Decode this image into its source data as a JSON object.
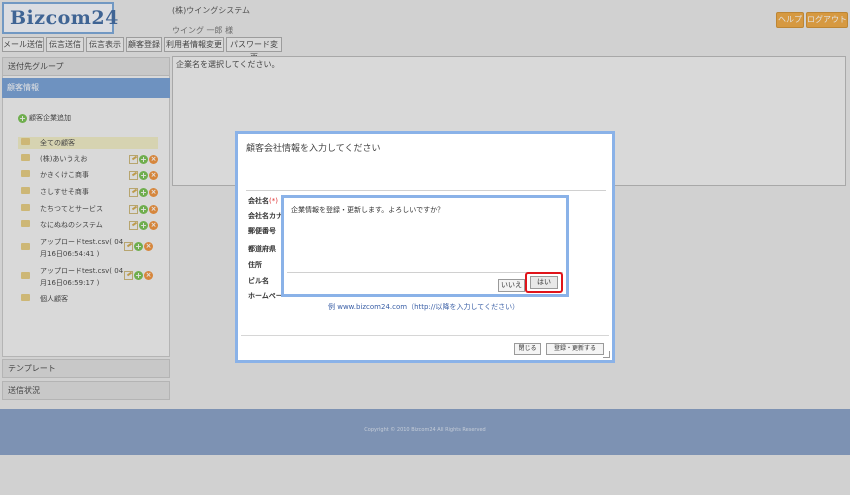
{
  "header": {
    "logo": "Bizcom24",
    "company": "(株)ウイングシステム",
    "user": "ウイング 一郎 様",
    "help_label": "ヘルプ",
    "logout_label": "ログアウト"
  },
  "nav": [
    "メール送信",
    "伝言送信",
    "伝言表示",
    "顧客登録",
    "利用者情報変更",
    "パスワード変更"
  ],
  "sidebar": {
    "send_group": "送付先グループ",
    "customer_info": "顧客情報",
    "add_company": "顧客企業追加",
    "items": [
      {
        "label": "全ての顧客"
      },
      {
        "label": "(株)あいうえお"
      },
      {
        "label": "かきくけこ商事"
      },
      {
        "label": "さしすせそ商事"
      },
      {
        "label": "たちつてとサービス"
      },
      {
        "label": "なにぬねのシステム"
      },
      {
        "label": "アップロードtest.csv( 04月16日06:54:41 )"
      },
      {
        "label": "アップロードtest.csv( 04月16日06:59:17 )"
      },
      {
        "label": "個人顧客"
      }
    ],
    "template": "テンプレート",
    "send_status": "送信状況"
  },
  "main": {
    "message": "企業名を選択してください。"
  },
  "dialog": {
    "title": "顧客会社情報を入力してください",
    "labels": {
      "company_name": "会社名",
      "required": "(*)",
      "company_kana": "会社名カナ",
      "postal_code": "郵便番号",
      "prefecture": "都道府県",
      "address": "住所",
      "building": "ビル名",
      "homepage": "ホームペー"
    },
    "example": "例 www.bizcom24.com（http://以降を入力してください）",
    "close_label": "閉じる",
    "register_label": "登録・更新する"
  },
  "confirm": {
    "message": "企業情報を登録・更新します。よろしいですか？",
    "no_label": "いいえ",
    "yes_label": "はい"
  },
  "footer": {
    "copyright": "Copyright © 2010 Bizcom24 All Rights Reserved"
  }
}
